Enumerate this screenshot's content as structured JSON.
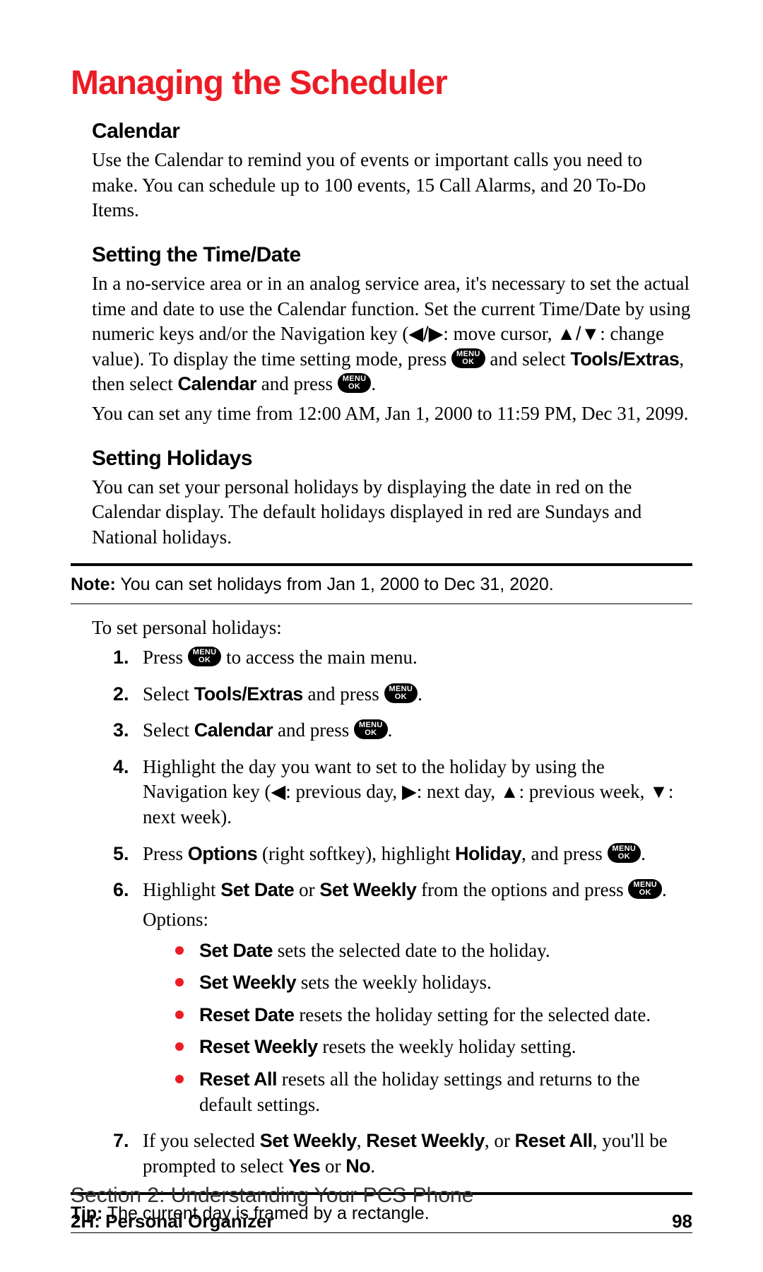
{
  "title": "Managing the Scheduler",
  "key": {
    "label_top": "MENU",
    "label_bottom": "OK"
  },
  "sections": {
    "calendar": {
      "heading": "Calendar",
      "body": "Use the Calendar to remind you of events or important calls you need to make. You can schedule up to 100 events, 15 Call Alarms, and 20 To-Do Items."
    },
    "time_date": {
      "heading": "Setting the Time/Date",
      "body_pre": "In a no-service area or in an analog service area, it's necessary to set the actual time and date to use the Calendar function. Set the current Time/Date by using numeric keys and/or the Navigation key (",
      "arrows_lr": "◀/▶",
      "body_mid1": ": move cursor, ",
      "arrows_ud": "▲/▼",
      "body_mid2": ": change value). To display the time setting mode, press ",
      "body_mid3": " and select ",
      "bold_tools": "Tools/Extras",
      "body_mid4": ", then select ",
      "bold_calendar": "Calendar",
      "body_mid5": " and press ",
      "body_mid6": ".",
      "body2": "You can set any time from 12:00 AM, Jan 1, 2000 to 11:59 PM, Dec 31, 2099."
    },
    "holidays": {
      "heading": "Setting Holidays",
      "body": "You can set your personal holidays by displaying the date in red on the Calendar display. The default holidays displayed in red are Sundays and National holidays."
    }
  },
  "note": {
    "label": "Note:",
    "text": " You can set holidays from Jan 1, 2000 to Dec 31, 2020."
  },
  "intro_steps": "To set personal holidays:",
  "steps": {
    "s1": {
      "num": "1.",
      "pre": "Press ",
      "post": " to access the main menu."
    },
    "s2": {
      "num": "2.",
      "pre": "Select ",
      "bold": "Tools/Extras",
      "mid": " and press ",
      "post": "."
    },
    "s3": {
      "num": "3.",
      "pre": "Select ",
      "bold": "Calendar",
      "mid": " and press ",
      "post": "."
    },
    "s4": {
      "num": "4.",
      "pre": "Highlight the day you want to set to the holiday by using the Navigation key (",
      "a1": "◀",
      "t1": ": previous day, ",
      "a2": "▶",
      "t2": ": next day, ",
      "a3": "▲",
      "t3": ": previous week, ",
      "a4": "▼",
      "t4": ": next week)."
    },
    "s5": {
      "num": "5.",
      "pre": "Press ",
      "bold1": "Options",
      "mid1": " (right softkey), highlight ",
      "bold2": "Holiday",
      "mid2": ", and press ",
      "post": "."
    },
    "s6": {
      "num": "6.",
      "pre": "Highlight ",
      "bold1": "Set Date",
      "mid1": " or ",
      "bold2": "Set Weekly",
      "mid2": " from the options and press ",
      "post": ".",
      "options_label": "Options:"
    },
    "s7": {
      "num": "7.",
      "pre": "If you selected ",
      "b1": "Set Weekly",
      "c1": ", ",
      "b2": "Reset Weekly",
      "c2": ", or ",
      "b3": "Reset All",
      "mid": ", you'll be prompted to select ",
      "b4": "Yes",
      "c3": " or ",
      "b5": "No",
      "post": "."
    }
  },
  "bullets": {
    "b1": {
      "bold": "Set Date",
      "text": " sets the selected date to the holiday."
    },
    "b2": {
      "bold": "Set Weekly",
      "text": " sets the weekly holidays."
    },
    "b3": {
      "bold": "Reset Date",
      "text": " resets the holiday setting for the selected date."
    },
    "b4": {
      "bold": "Reset Weekly",
      "text": " resets the weekly holiday setting."
    },
    "b5": {
      "bold": "Reset All",
      "text": " resets all the holiday settings and returns to the default settings."
    }
  },
  "tip": {
    "label": "Tip:",
    "text": " The current day is framed by a rectangle."
  },
  "footer": {
    "section": "Section 2: Understanding Your PCS Phone",
    "sub": "2H: Personal Organizer",
    "page": "98"
  }
}
